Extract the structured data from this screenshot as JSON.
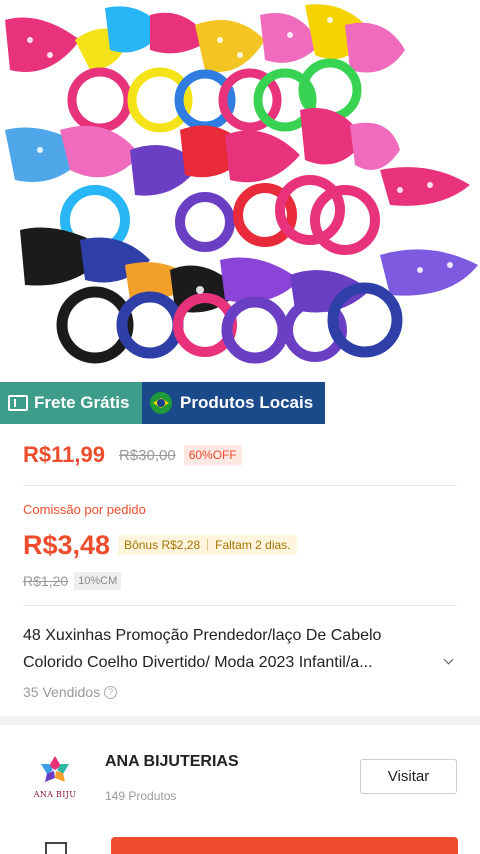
{
  "product_image": {
    "icon": "hair-ties-photo",
    "colors": [
      "#e8327c",
      "#2f7de1",
      "#f2d22a",
      "#6b3fc4",
      "#1b1b1b",
      "#ff8a00",
      "#29b6f6",
      "#39d353"
    ]
  },
  "badges": {
    "free_shipping": "Frete Grátis",
    "local_products": "Produtos Locais"
  },
  "price": {
    "current": "R$11,99",
    "original": "R$30,00",
    "discount": "60%OFF"
  },
  "commission": {
    "label": "Comissão por pedido",
    "value": "R$3,48",
    "bonus": "Bônus R$2,28",
    "days_left": "Faltam 2 dias.",
    "base": "R$1,20",
    "rate": "10%CM"
  },
  "product": {
    "title_line1": "48 Xuxinhas Promoção Prendedor/laço De Cabelo",
    "title_line2": "Colorido Coelho Divertido/ Moda 2023 Infantil/a...",
    "sold": "35 Vendidos"
  },
  "shop": {
    "name": "ANA BIJUTERIAS",
    "products": "149 Produtos",
    "logo_text": "ANA BIJU",
    "visit": "Visitar"
  },
  "colors": {
    "accent": "#ee4d2d",
    "free_shipping_bg": "#3e9c8a",
    "local_bg": "#1a4a8a"
  }
}
